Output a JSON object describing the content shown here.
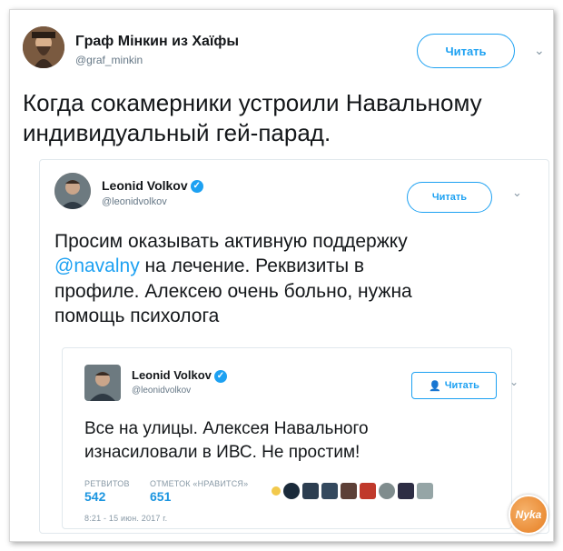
{
  "outer": {
    "name": "Γpaф Mінкин из Хаїфы",
    "handle": "@graf_minkin",
    "follow_label": "Читать",
    "text_line1": "Когда сокамерники устроили Навальному",
    "text_line2": "индивидуальный гей-парад."
  },
  "quote1": {
    "name": "Leonid Volkov",
    "handle": "@leonidvolkov",
    "follow_label": "Читать",
    "line1": "Просим оказывать активную поддержку",
    "mention": "@navalny",
    "line2_rest": " на лечение. Реквизиты в",
    "line3": "профиле. Алексею очень больно, нужна",
    "line4": "помощь психолога"
  },
  "quote2": {
    "name": "Leonid Volkov",
    "handle": "@leonidvolkov",
    "follow_label": "Читать",
    "line1": "Все на улицы. Алексея Навального",
    "line2": "изнасиловали в ИВС. Не простим!",
    "retweets_label": "РЕТВИТОВ",
    "retweets_value": "542",
    "likes_label": "ОТМЕТОК «НРАВИТСЯ»",
    "likes_value": "651",
    "timestamp": "8:21 - 15 июн. 2017 г."
  },
  "watermark": "Nyka",
  "colors": {
    "accent": "#1da1f2",
    "text": "#14171a",
    "muted": "#657786"
  }
}
